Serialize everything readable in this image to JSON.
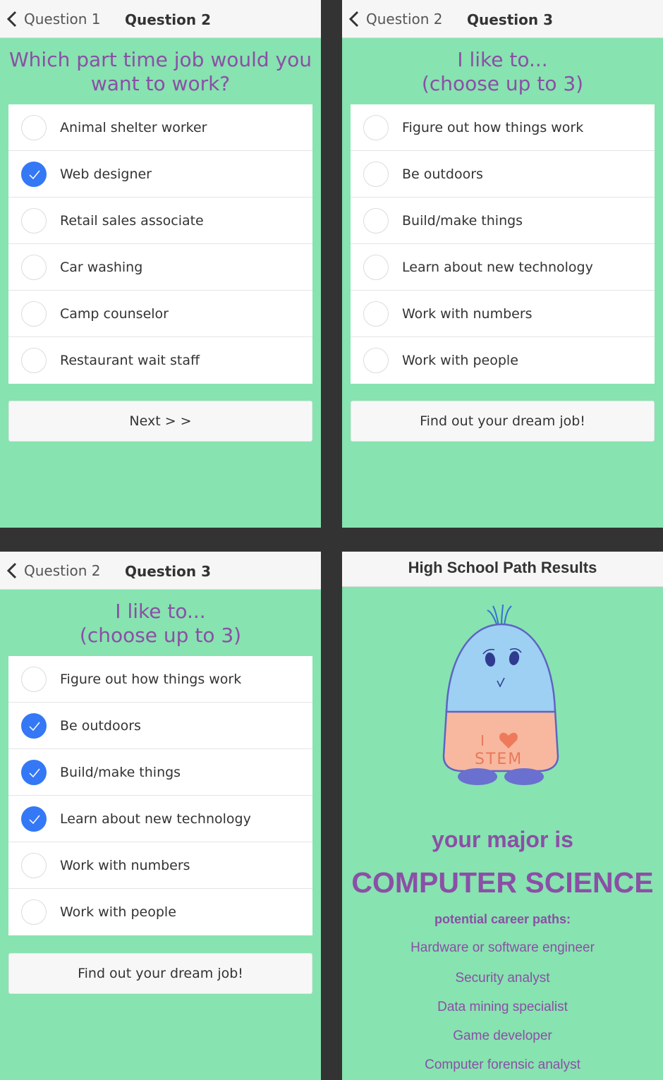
{
  "screen1": {
    "back_label": "Question 1",
    "title": "Question 2",
    "question_lines": [
      "Which part time job would you",
      "want to work?"
    ],
    "options": [
      {
        "label": "Animal shelter worker",
        "checked": false
      },
      {
        "label": "Web designer",
        "checked": true
      },
      {
        "label": "Retail sales associate",
        "checked": false
      },
      {
        "label": "Car washing",
        "checked": false
      },
      {
        "label": "Camp counselor",
        "checked": false
      },
      {
        "label": "Restaurant wait staff",
        "checked": false
      }
    ],
    "button_label": "Next > >"
  },
  "screen2": {
    "back_label": "Question 2",
    "title": "Question 3",
    "question_lines": [
      "I like to...",
      "(choose up to 3)"
    ],
    "options": [
      {
        "label": "Figure out how things work",
        "checked": false
      },
      {
        "label": "Be outdoors",
        "checked": false
      },
      {
        "label": "Build/make things",
        "checked": false
      },
      {
        "label": "Learn about new technology",
        "checked": false
      },
      {
        "label": "Work with numbers",
        "checked": false
      },
      {
        "label": "Work with people",
        "checked": false
      }
    ],
    "button_label": "Find out your dream job!"
  },
  "screen3": {
    "back_label": "Question 2",
    "title": "Question 3",
    "question_lines": [
      "I like to...",
      "(choose up to 3)"
    ],
    "options": [
      {
        "label": "Figure out how things work",
        "checked": false
      },
      {
        "label": "Be outdoors",
        "checked": true
      },
      {
        "label": "Build/make things",
        "checked": true
      },
      {
        "label": "Learn about new technology",
        "checked": true
      },
      {
        "label": "Work with numbers",
        "checked": false
      },
      {
        "label": "Work with people",
        "checked": false
      }
    ],
    "button_label": "Find out your dream job!"
  },
  "results": {
    "title": "High School Path Results",
    "mascot_text_top": "I",
    "mascot_text_bottom": "STEM",
    "major_intro": "your major is",
    "major": "COMPUTER SCIENCE",
    "paths_heading": "potential career paths:",
    "careers": [
      "Hardware or software engineer",
      "Security analyst",
      "Data mining specialist",
      "Game developer",
      "Computer forensic analyst"
    ]
  },
  "colors": {
    "background": "#87e3b0",
    "accent_purple": "#8b4fa6",
    "check_blue": "#3478f6"
  }
}
